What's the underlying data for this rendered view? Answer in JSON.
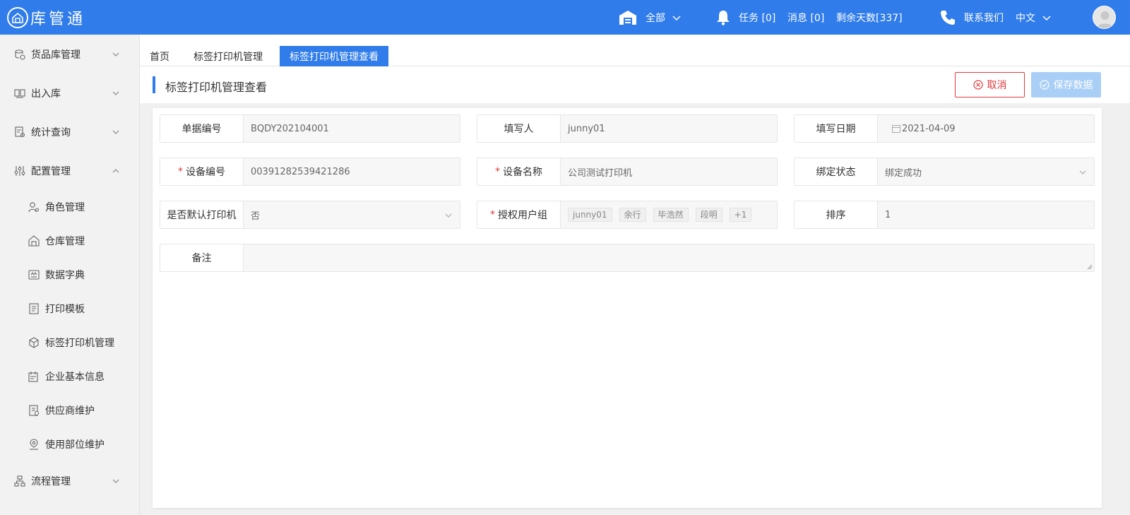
{
  "app": {
    "name": "库管通"
  },
  "topbar": {
    "warehouse": "全部",
    "tasks": "任务 [0]",
    "messages": "消息 [0]",
    "remaining_days": "剩余天数[337]",
    "contact": "联系我们",
    "language": "中文"
  },
  "sidebar": {
    "groups": [
      {
        "label": "货品库管理",
        "icon": "box-stack-icon"
      },
      {
        "label": "出入库",
        "icon": "transfer-icon"
      },
      {
        "label": "统计查询",
        "icon": "stats-icon"
      },
      {
        "label": "配置管理",
        "icon": "settings-sliders-icon"
      }
    ],
    "sub_items": [
      {
        "label": "角色管理",
        "icon": "user-gear-icon"
      },
      {
        "label": "仓库管理",
        "icon": "warehouse-icon"
      },
      {
        "label": "数据字典",
        "icon": "dictionary-icon"
      },
      {
        "label": "打印模板",
        "icon": "document-icon"
      },
      {
        "label": "标签打印机管理",
        "icon": "cube-icon"
      },
      {
        "label": "企业基本信息",
        "icon": "calendar-doc-icon"
      },
      {
        "label": "供应商维护",
        "icon": "supplier-doc-icon"
      },
      {
        "label": "使用部位维护",
        "icon": "location-user-icon"
      }
    ],
    "last_group": {
      "label": "流程管理",
      "icon": "flow-icon"
    }
  },
  "tabs": [
    {
      "label": "首页"
    },
    {
      "label": "标签打印机管理"
    },
    {
      "label": "标签打印机管理查看"
    }
  ],
  "page": {
    "title": "标签打印机管理查看",
    "cancel_label": "取消",
    "save_label": "保存数据"
  },
  "form": {
    "doc_no": {
      "label": "单据编号",
      "value": "BQDY202104001"
    },
    "writer": {
      "label": "填写人",
      "value": "junny01"
    },
    "date": {
      "label": "填写日期",
      "value": "2021-04-09"
    },
    "device_no": {
      "label": "设备编号",
      "value": "00391282539421286",
      "required": "*"
    },
    "device_name": {
      "label": "设备名称",
      "value": "公司测试打印机",
      "required": "*"
    },
    "bind_status": {
      "label": "绑定状态",
      "value": "绑定成功"
    },
    "is_default": {
      "label": "是否默认打印机",
      "value": "否"
    },
    "auth_groups": {
      "label": "授权用户组",
      "required": "*",
      "tags": [
        "junny01",
        "余行",
        "毕浩然",
        "段明",
        "+1"
      ]
    },
    "sort": {
      "label": "排序",
      "value": "1"
    },
    "remark": {
      "label": "备注",
      "value": ""
    }
  },
  "colors": {
    "primary": "#2f7cea",
    "danger": "#e0393e",
    "save_disabled": "#a9cff7"
  }
}
